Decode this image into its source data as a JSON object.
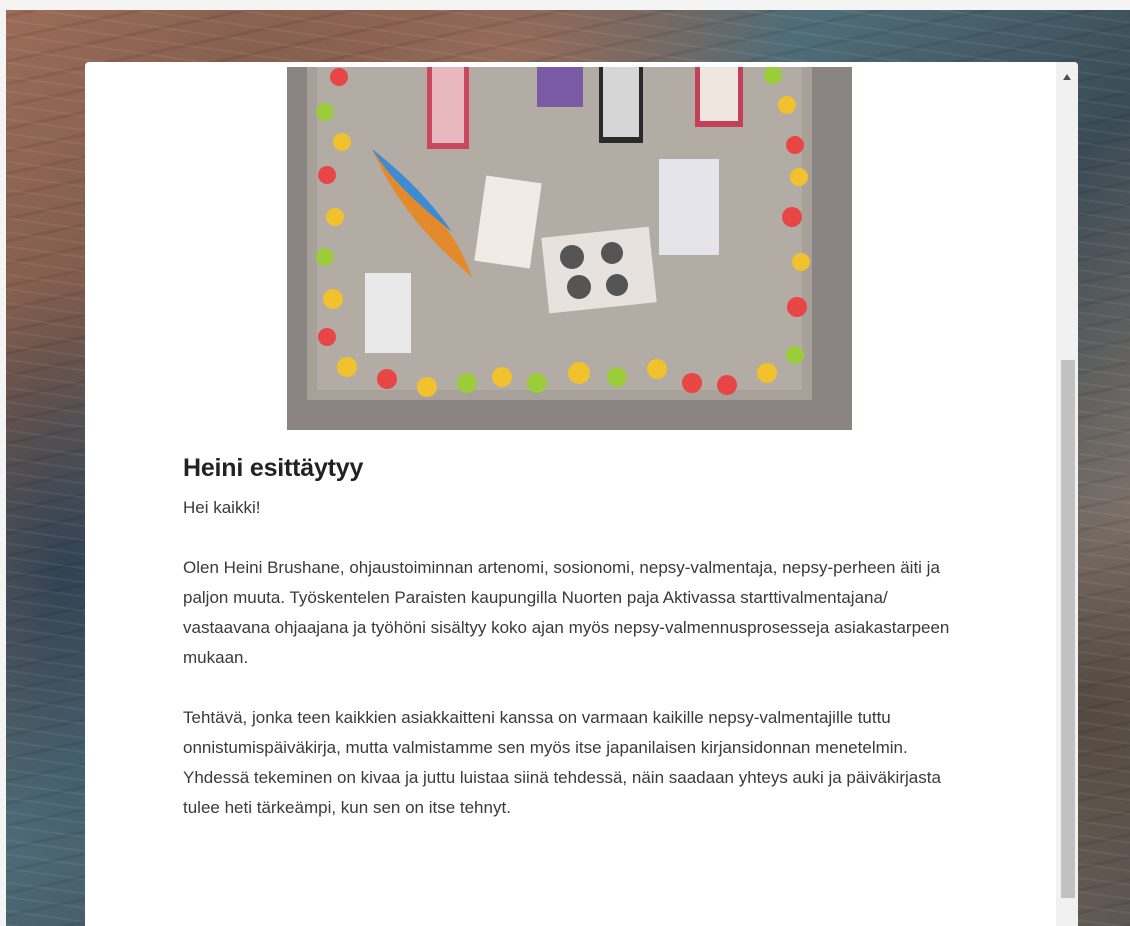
{
  "post": {
    "title": "Heini esittäytyy",
    "greeting": "Hei kaikki!",
    "paragraph_1": "Olen Heini Brushane, ohjaustoiminnan artenomi, sosionomi, nepsy-valmentaja, nepsy-perheen äiti ja paljon muuta. Työskentelen Paraisten kaupungilla Nuorten paja Aktivassa starttivalmentajana/ vastaavana ohjaajana ja työhöni sisältyy koko ajan myös nepsy-valmennusprosesseja asiakastarpeen mukaan.",
    "paragraph_2": "Tehtävä, jonka teen kaikkien asiakkaitteni kanssa on varmaan kaikille nepsy-valmentajille tuttu onnistumispäiväkirja, mutta valmistamme sen myös itse japanilaisen kirjansidonnan menetelmin. Yhdessä tekeminen on kivaa ja juttu luistaa siinä tehdessä, näin saadaan yhteys auki ja päiväkirjasta tulee heti tärkeämpi, kun sen on itse tehnyt.",
    "image_icon": "photo-bulletin-board-with-lights"
  },
  "scrollbar": {
    "up_icon": "triangle-up-icon"
  },
  "colors": {
    "panel": "#ffffff",
    "text": "#3a3a3a",
    "heading": "#222222",
    "scroll_track": "#f1f1f1",
    "scroll_thumb": "#c1c1c1"
  }
}
